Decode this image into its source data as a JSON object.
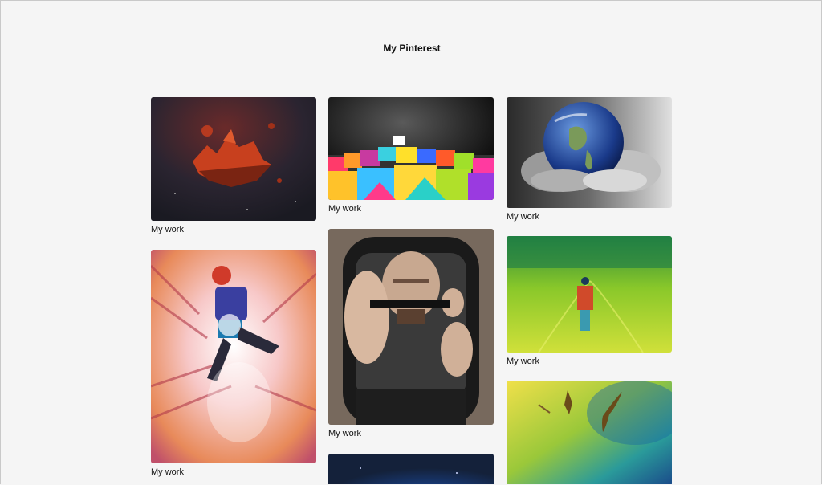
{
  "page": {
    "title": "My Pinterest"
  },
  "pins": [
    {
      "caption": "My work",
      "image": "floating-red-rock-island"
    },
    {
      "caption": "My work",
      "image": "colorful-cubes"
    },
    {
      "caption": "My work",
      "image": "earth-in-hands"
    },
    {
      "caption": "My work",
      "image": "neon-dancer"
    },
    {
      "caption": "My work",
      "image": "man-in-backpack"
    },
    {
      "caption": "My work",
      "image": "person-in-green-field"
    },
    {
      "caption": "",
      "image": "dark-blue-space"
    },
    {
      "caption": "",
      "image": "birds-over-watercolor"
    }
  ]
}
